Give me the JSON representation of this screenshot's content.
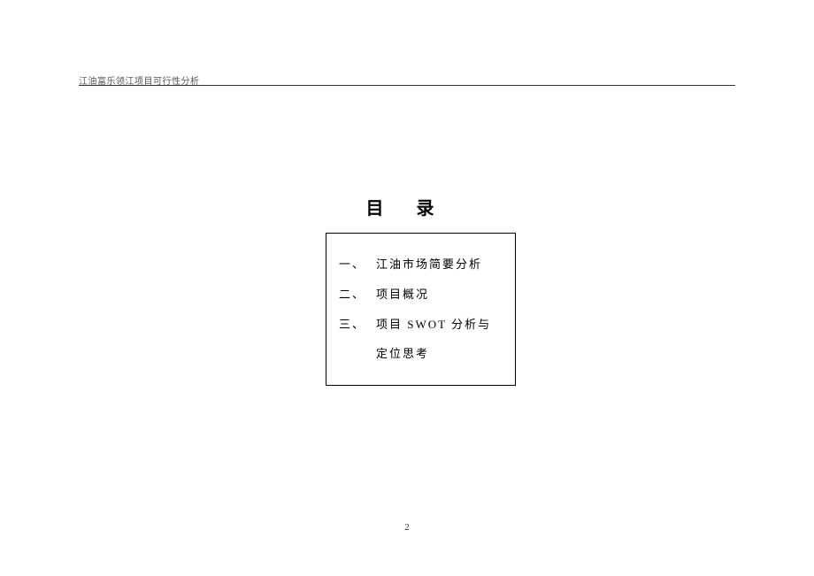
{
  "header": {
    "text": "江油富乐领江项目可行性分析"
  },
  "toc": {
    "title": "目 录",
    "items": [
      {
        "num": "一、",
        "text": "江油市场简要分析"
      },
      {
        "num": "二、",
        "text": "项目概况"
      },
      {
        "num": "三、",
        "text": "项目 SWOT 分析与定位思考"
      }
    ]
  },
  "pageNumber": "2"
}
